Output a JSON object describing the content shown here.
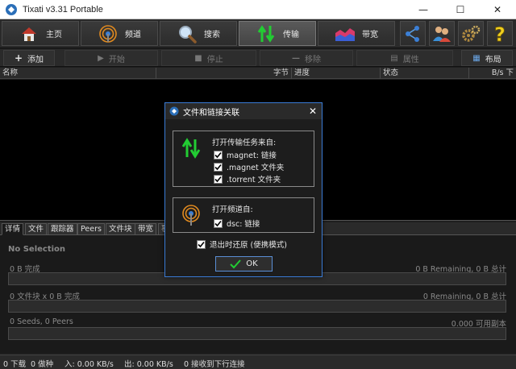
{
  "window": {
    "title": "Tixati v3.31 Portable",
    "minimize_glyph": "—",
    "maximize_glyph": "☐",
    "close_glyph": "✕"
  },
  "main_toolbar": {
    "home": "主页",
    "channels": "频道",
    "search": "搜索",
    "transfers": "传输",
    "bandwidth": "带宽",
    "icon_buttons": [
      "share-network-icon",
      "users-icon",
      "gears-icon",
      "help-icon"
    ]
  },
  "action_toolbar": {
    "add": "添加",
    "start": "开始",
    "stop": "停止",
    "remove": "移除",
    "properties": "属性",
    "layout": "布局"
  },
  "list_columns": [
    "名称",
    "字节",
    "进度",
    "状态",
    "B/s 下"
  ],
  "bottom_tabs": [
    "详情",
    "文件",
    "跟踪器",
    "Peers",
    "文件块",
    "带宽",
    "事"
  ],
  "detail": {
    "no_selection": "No Selection",
    "bytes_complete": "0 B 完成",
    "bytes_remaining": "0 B Remaining,  0 B 总计",
    "pieces_complete": "0 文件块  x  0 B 完成",
    "pieces_remaining": "0 Remaining,  0 B 总计",
    "seeds_peers": "0 Seeds, 0 Peers",
    "copies": "0.000 可用副本"
  },
  "status_bar": {
    "downloading": "0 下载",
    "seeding": "0 做种",
    "in_rate": "入: 0.00 KB/s",
    "out_rate": "出: 0.00 KB/s",
    "connections": "0  接收到下行连接"
  },
  "dialog": {
    "title": "文件和链接关联",
    "close": "✕",
    "transfer_heading": "打开传输任务来自:",
    "transfer_options": [
      {
        "label": "magnet: 链接",
        "checked": true
      },
      {
        "label": ".magnet 文件夹",
        "checked": true
      },
      {
        "label": ".torrent 文件夹",
        "checked": true
      }
    ],
    "channel_heading": "打开频道自:",
    "channel_options": [
      {
        "label": "dsc: 链接",
        "checked": true
      }
    ],
    "restore_on_exit": "退出时还原 (便携模式)",
    "restore_checked": true,
    "ok": "OK"
  },
  "colors": {
    "accent_green": "#22cc33",
    "dialog_border": "#3a7bd5",
    "background": "#1a1a1a"
  }
}
